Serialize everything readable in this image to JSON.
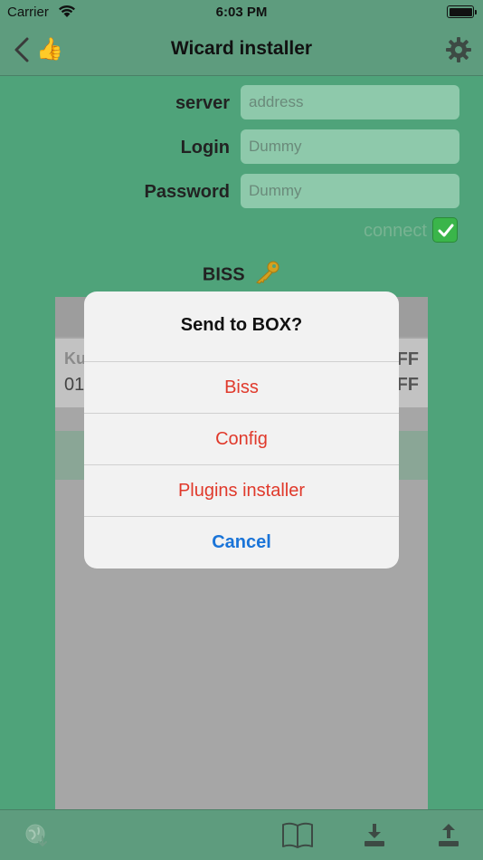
{
  "status_bar": {
    "carrier": "Carrier",
    "time": "6:03 PM"
  },
  "navbar": {
    "title": "Wicard installer",
    "thumb_emoji": "👍"
  },
  "form": {
    "server": {
      "label": "server",
      "placeholder": "address"
    },
    "login": {
      "label": "Login",
      "placeholder": "Dummy"
    },
    "password": {
      "label": "Password",
      "placeholder": "Dummy"
    },
    "connect_label": "connect"
  },
  "biss": {
    "label": "BISS"
  },
  "table": {
    "row_left_top": "Ku",
    "row_left_bottom": "01",
    "row_right_top": "FF",
    "row_right_bottom": "FF"
  },
  "alert": {
    "title": "Send to BOX?",
    "options": [
      "Biss",
      "Config",
      "Plugins installer"
    ],
    "cancel": "Cancel"
  },
  "colors": {
    "accent_red": "#e0392b",
    "accent_blue": "#1a74d8",
    "bg_green": "#4fa37a"
  }
}
